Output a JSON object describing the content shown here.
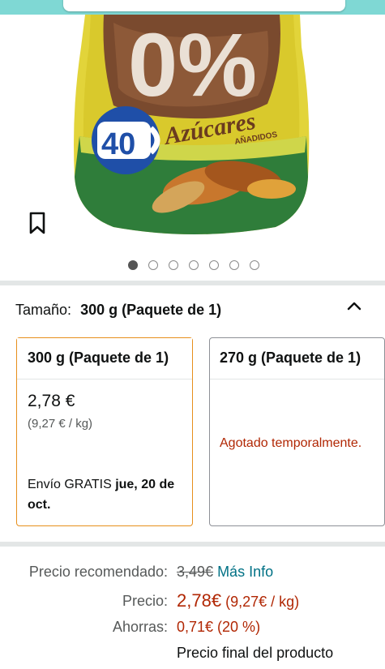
{
  "product": {
    "badge_text": "0%",
    "brand_number": "40",
    "label_main": "Azúcares",
    "label_sub": "AÑADIDOS"
  },
  "carousel": {
    "count": 7,
    "active_index": 0
  },
  "size": {
    "label": "Tamaño:",
    "selected": "300 g (Paquete de 1)"
  },
  "options": [
    {
      "title": "300 g (Paquete de 1)",
      "price": "2,78 €",
      "unit_price": "(9,27 € / kg)",
      "shipping_prefix": "Envío GRATIS",
      "shipping_date": "jue, 20 de oct."
    },
    {
      "title": "270 g (Paquete de 1)",
      "status": "Agotado temporalmente."
    }
  ],
  "pricing": {
    "recommended_label": "Precio recomendado:",
    "recommended_value": "3,49€",
    "more_info": "Más Info",
    "price_label": "Precio:",
    "price_value": "2,78€",
    "price_unit": "(9,27€ / kg)",
    "savings_label": "Ahorras:",
    "savings_value": "0,71€ (20 %)",
    "final_note": "Precio final del producto"
  },
  "colors": {
    "selected_border": "#e78f1c",
    "deal_red": "#b12704",
    "link": "#007185",
    "header": "#7fd8d4"
  }
}
